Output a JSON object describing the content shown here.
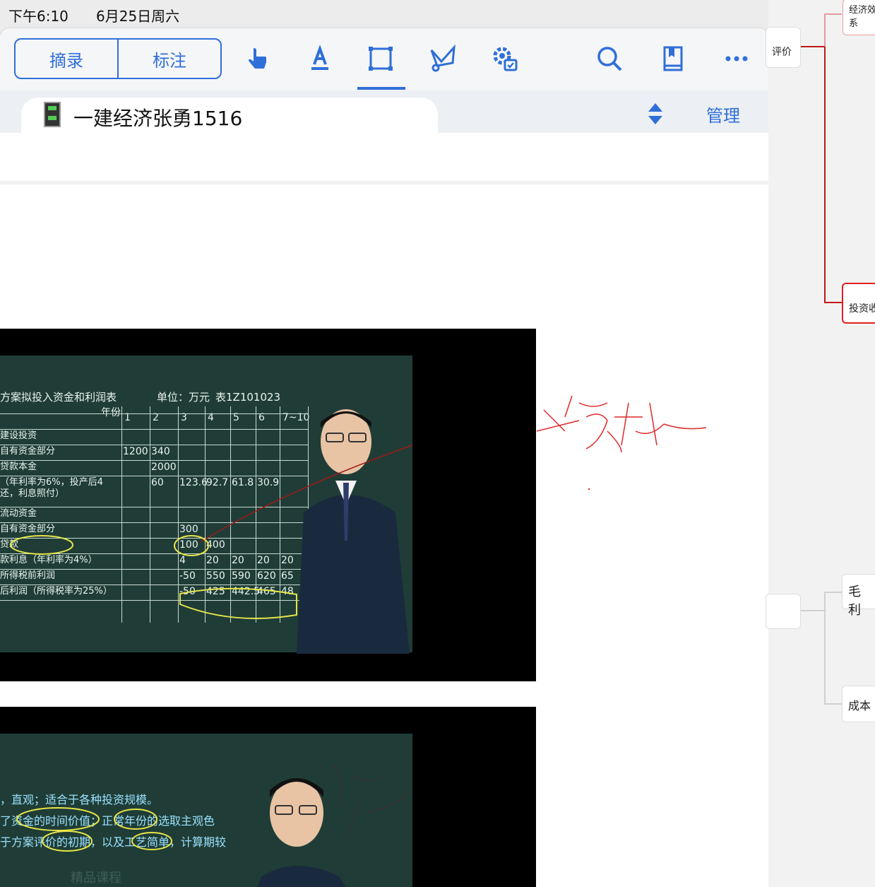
{
  "status": {
    "time": "下午6:10",
    "date": "6月25日周六"
  },
  "toolbar": {
    "excerpt_label": "摘录",
    "annotate_label": "标注",
    "accent_color": "#2f6fd8",
    "tools": [
      "hand-pointer-icon",
      "text-highlight-icon",
      "rect-select-icon",
      "lasso-icon",
      "settings-gear-icon",
      "search-icon",
      "bookmark-icon",
      "more-icon"
    ]
  },
  "tab": {
    "title": "一建经济张勇1516",
    "manage_label": "管理"
  },
  "video1": {
    "title": "方案拟投入资金和利润表",
    "unit": "单位：万元",
    "table_no": "表1Z101023",
    "year_header": "年份",
    "cols": [
      "1",
      "2",
      "3",
      "4",
      "5",
      "6",
      "7~10"
    ],
    "rows": [
      [
        "建设投资",
        "",
        "",
        "",
        "",
        "",
        "",
        ""
      ],
      [
        "自有资金部分",
        "1200",
        "340",
        "",
        "",
        "",
        "",
        ""
      ],
      [
        "贷款本金",
        "",
        "2000",
        "",
        "",
        "",
        "",
        ""
      ],
      [
        "（年利率为6%，投产后4\n还，利息照付）",
        "",
        "60",
        "123.6",
        "92.7",
        "61.8",
        "30.9",
        ""
      ],
      [
        "流动资金",
        "",
        "",
        "",
        "",
        "",
        "",
        ""
      ],
      [
        "自有资金部分",
        "",
        "",
        "300",
        "",
        "",
        "",
        ""
      ],
      [
        "贷款",
        "",
        "",
        "100",
        "400",
        "",
        "",
        ""
      ],
      [
        "款利息（年利率为4%）",
        "",
        "",
        "4",
        "20",
        "20",
        "20",
        "20"
      ],
      [
        "所得税前利润",
        "",
        "",
        "-50",
        "550",
        "590",
        "620",
        "65"
      ],
      [
        "后利润（所得税率为25%）",
        "",
        "",
        "-50",
        "425",
        "442.5",
        "465",
        "48"
      ]
    ]
  },
  "video2": {
    "line1": "，直观；适合于各种投资规模。",
    "line2": "了资金的时间价值；正常年份的选取主观色",
    "line3": "于方案评价的初期，以及工艺简单，计算期较",
    "footer": "精品课程"
  },
  "mindmap": {
    "node_top": "经济效\n系",
    "node_eval": "评价",
    "node_invest": "投资收",
    "node_gross": "毛利",
    "node_cost": "成本"
  }
}
